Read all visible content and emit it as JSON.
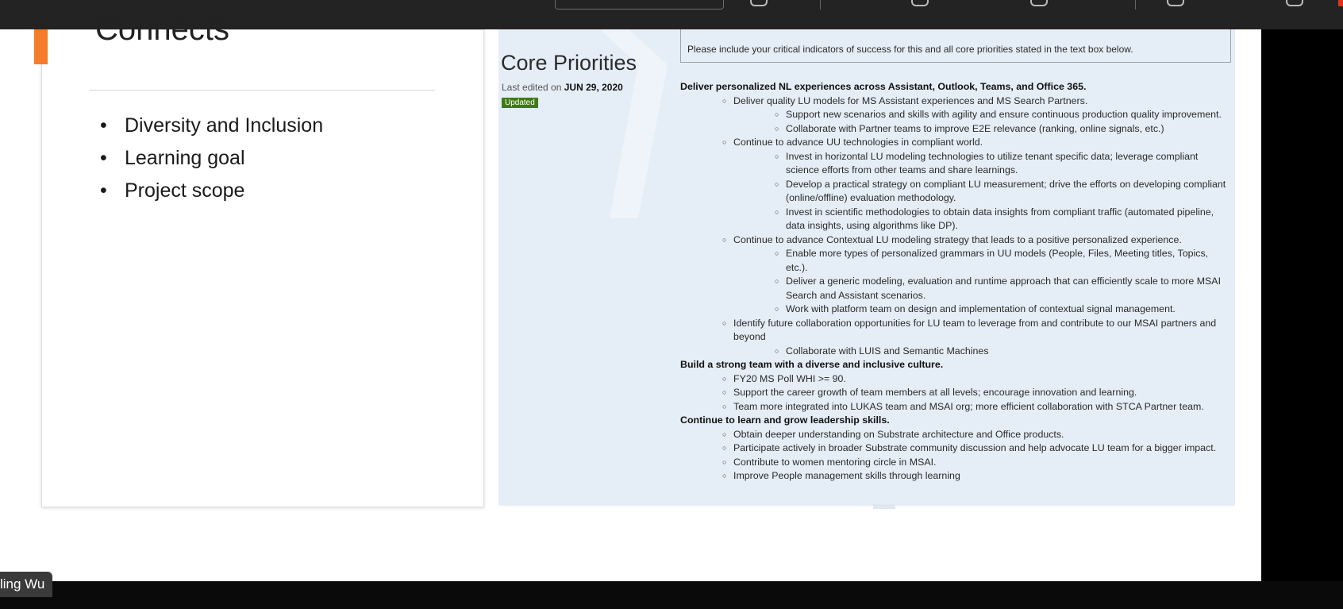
{
  "slide": {
    "title": "Connects",
    "bullets": [
      "Diversity and Inclusion",
      "Learning goal",
      "Project scope"
    ]
  },
  "panel": {
    "note": "Please include your critical indicators of success for this and all core priorities stated in the text box below.",
    "heading": "Core Priorities",
    "edited_prefix": "Last edited on",
    "edited_date": "JUN 29, 2020",
    "badge": "Updated",
    "items": [
      {
        "lvl": 0,
        "text": "Deliver personalized NL experiences across Assistant, Outlook, Teams, and Office 365."
      },
      {
        "lvl": 1,
        "text": "Deliver quality LU models for MS Assistant experiences and MS Search Partners."
      },
      {
        "lvl": 2,
        "text": "Support new scenarios and skills with agility and ensure continuous production quality improvement."
      },
      {
        "lvl": 2,
        "text": "Collaborate with Partner teams to improve E2E relevance (ranking, online signals, etc.)"
      },
      {
        "lvl": 1,
        "text": "Continue to advance UU technologies in compliant world."
      },
      {
        "lvl": 2,
        "text": "Invest in horizontal LU modeling technologies to utilize tenant specific data; leverage compliant science efforts from other teams and share learnings."
      },
      {
        "lvl": 2,
        "text": "Develop a practical strategy on compliant LU measurement; drive the efforts on developing compliant (online/offline) evaluation methodology."
      },
      {
        "lvl": 2,
        "text": "Invest in scientific methodologies to obtain data insights from compliant traffic (automated pipeline, data insights, using algorithms like DP)."
      },
      {
        "lvl": 1,
        "text": "Continue to advance Contextual LU modeling strategy that leads to a positive personalized experience."
      },
      {
        "lvl": 2,
        "text": "Enable more types of personalized grammars in UU models (People, Files, Meeting titles, Topics, etc.)."
      },
      {
        "lvl": 2,
        "text": "Deliver a generic modeling, evaluation and runtime approach that can efficiently scale to more MSAI Search and Assistant scenarios."
      },
      {
        "lvl": 2,
        "text": "Work with platform team on design and implementation of contextual signal management."
      },
      {
        "lvl": 1,
        "text": "Identify future collaboration opportunities for LU team to leverage from and contribute to our MSAI partners and beyond"
      },
      {
        "lvl": 2,
        "text": "Collaborate with LUIS and Semantic Machines"
      },
      {
        "lvl": 0,
        "text": "Build a strong team with a diverse and inclusive culture."
      },
      {
        "lvl": 1,
        "text": "FY20 MS Poll WHI >= 90."
      },
      {
        "lvl": 1,
        "text": "Support the career growth of team members at all levels; encourage innovation and learning."
      },
      {
        "lvl": 1,
        "text": "Team more integrated into LUKAS team and MSAI org; more efficient collaboration with STCA Partner team."
      },
      {
        "lvl": 0,
        "text": "Continue to learn and grow leadership skills."
      },
      {
        "lvl": 1,
        "text": "Obtain deeper understanding on Substrate architecture and Office products."
      },
      {
        "lvl": 1,
        "text": "Participate actively in broader Substrate community discussion and help advocate LU team for a bigger impact."
      },
      {
        "lvl": 1,
        "text": "Contribute to women mentoring circle in MSAI."
      },
      {
        "lvl": 1,
        "text": "Improve People management skills through learning"
      }
    ]
  },
  "participant": {
    "name": "ling Wu"
  },
  "colors": {
    "accent": "#f47c2a",
    "badge": "#3d7c12",
    "panel_bg": "#e5eef7"
  }
}
